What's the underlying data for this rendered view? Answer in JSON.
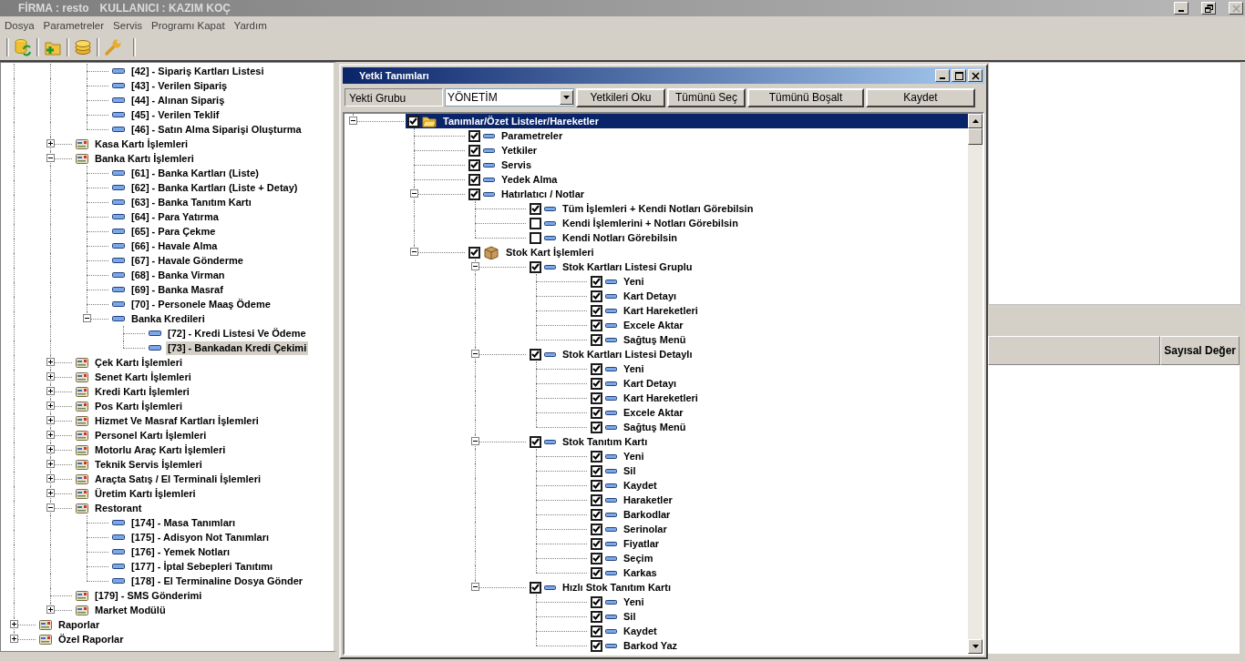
{
  "app_title": {
    "firm": "FİRMA : resto",
    "user": "KULLANICI : KAZIM KOÇ"
  },
  "menu": [
    "Dosya",
    "Parametreler",
    "Servis",
    "Programı Kapat",
    "Yardım"
  ],
  "nav_tree": [
    {
      "children": [
        {
          "children": [
            {
              "label": "[42] - Sipariş Kartları Listesi",
              "kind": "item",
              "selected": false
            },
            {
              "label": "[43] - Verilen Sipariş",
              "kind": "item",
              "selected": false
            },
            {
              "label": "[44] - Alınan Sipariş",
              "kind": "item",
              "selected": false
            },
            {
              "label": "[45] - Verilen Teklif",
              "kind": "item",
              "selected": false
            },
            {
              "label": "[46] - Satın Alma Siparişi Oluşturma",
              "kind": "item",
              "selected": false
            }
          ]
        },
        {
          "label": "Kasa Kartı İşlemleri",
          "kind": "module",
          "expanded": false,
          "selected": false
        },
        {
          "label": "Banka Kartı İşlemleri",
          "kind": "module",
          "expanded": true,
          "selected": false,
          "children": [
            {
              "label": "[61] - Banka Kartları (Liste)",
              "kind": "item",
              "selected": false
            },
            {
              "label": "[62] - Banka Kartları (Liste + Detay)",
              "kind": "item",
              "selected": false
            },
            {
              "label": "[63] - Banka Tanıtım Kartı",
              "kind": "item",
              "selected": false
            },
            {
              "label": "[64] - Para Yatırma",
              "kind": "item",
              "selected": false
            },
            {
              "label": "[65] - Para Çekme",
              "kind": "item",
              "selected": false
            },
            {
              "label": "[66] - Havale Alma",
              "kind": "item",
              "selected": false
            },
            {
              "label": "[67] - Havale Gönderme",
              "kind": "item",
              "selected": false
            },
            {
              "label": "[68] - Banka Virman",
              "kind": "item",
              "selected": false
            },
            {
              "label": "[69] - Banka Masraf",
              "kind": "item",
              "selected": false
            },
            {
              "label": "[70] - Personele Maaş Ödeme",
              "kind": "item",
              "selected": false
            },
            {
              "label": "Banka Kredileri",
              "kind": "item",
              "expanded": true,
              "selected": false,
              "children": [
                {
                  "label": "[72] - Kredi Listesi Ve Ödeme",
                  "kind": "item",
                  "selected": false
                },
                {
                  "label": "[73] - Bankadan Kredi Çekimi",
                  "kind": "item",
                  "selected": true
                }
              ]
            }
          ]
        },
        {
          "label": "Çek Kartı İşlemleri",
          "kind": "module",
          "expanded": false,
          "selected": false
        },
        {
          "label": "Senet Kartı İşlemleri",
          "kind": "module",
          "expanded": false,
          "selected": false
        },
        {
          "label": "Kredi Kartı İşlemleri",
          "kind": "module",
          "expanded": false,
          "selected": false
        },
        {
          "label": "Pos Kartı İşlemleri",
          "kind": "module",
          "expanded": false,
          "selected": false
        },
        {
          "label": "Hizmet Ve Masraf Kartları İşlemleri",
          "kind": "module",
          "expanded": false,
          "selected": false
        },
        {
          "label": "Personel Kartı İşlemleri",
          "kind": "module",
          "expanded": false,
          "selected": false
        },
        {
          "label": "Motorlu Araç Kartı İşlemleri",
          "kind": "module",
          "expanded": false,
          "selected": false
        },
        {
          "label": "Teknik Servis İşlemleri",
          "kind": "module",
          "expanded": false,
          "selected": false
        },
        {
          "label": "Araçta Satış / El Terminali İşlemleri",
          "kind": "module",
          "expanded": false,
          "selected": false
        },
        {
          "label": "Üretim Kartı İşlemleri",
          "kind": "module",
          "expanded": false,
          "selected": false
        },
        {
          "label": "Restorant",
          "kind": "module",
          "expanded": true,
          "selected": false,
          "children": [
            {
              "label": "[174] - Masa Tanımları",
              "kind": "item",
              "selected": false
            },
            {
              "label": "[175] - Adisyon Not Tanımları",
              "kind": "item",
              "selected": false
            },
            {
              "label": "[176] - Yemek Notları",
              "kind": "item",
              "selected": false
            },
            {
              "label": "[177] - İptal Sebepleri Tanıtımı",
              "kind": "item",
              "selected": false
            },
            {
              "label": "[178] - El Terminaline Dosya Gönder",
              "kind": "item",
              "selected": false
            }
          ]
        },
        {
          "label": "[179] - SMS Gönderimi",
          "kind": "module",
          "selected": false
        },
        {
          "label": "Market Modülü",
          "kind": "module",
          "expanded": false,
          "selected": false
        }
      ]
    },
    {
      "label": "Raporlar",
      "kind": "module",
      "expanded": false,
      "selected": false
    },
    {
      "label": "Özel Raporlar",
      "kind": "module",
      "expanded": false,
      "selected": false
    }
  ],
  "dialog": {
    "title": "Yetki Tanımları",
    "group_label": "Yekti Grubu",
    "group_value": "YÖNETİM",
    "buttons": [
      "Yetkileri Oku",
      "Tümünü Seç",
      "Tümünü Boşalt",
      "Kaydet"
    ],
    "tree": [
      {
        "label": "Tanımlar/Özet Listeler/Hareketler",
        "kind": "folder",
        "checked": true,
        "expanded": true,
        "selected": true,
        "children": [
          {
            "label": "Parametreler",
            "kind": "item",
            "checked": true,
            "selected": false
          },
          {
            "label": "Yetkiler",
            "kind": "item",
            "checked": true,
            "selected": false
          },
          {
            "label": "Servis",
            "kind": "item",
            "checked": true,
            "selected": false
          },
          {
            "label": "Yedek Alma",
            "kind": "item",
            "checked": true,
            "selected": false
          },
          {
            "label": "Hatırlatıcı / Notlar",
            "kind": "item",
            "checked": true,
            "expanded": true,
            "selected": false,
            "children": [
              {
                "label": "Tüm İşlemleri + Kendi Notları Görebilsin",
                "kind": "item",
                "checked": true,
                "selected": false
              },
              {
                "label": "Kendi İşlemlerini + Notları Görebilsin",
                "kind": "item",
                "checked": false,
                "selected": false
              },
              {
                "label": "Kendi Notları Görebilsin",
                "kind": "item",
                "checked": false,
                "selected": false
              }
            ]
          },
          {
            "label": "Stok Kart İşlemleri",
            "kind": "box",
            "checked": true,
            "expanded": true,
            "selected": false,
            "children": [
              {
                "label": "Stok Kartları Listesi Gruplu",
                "kind": "item",
                "checked": true,
                "expanded": true,
                "selected": false,
                "children": [
                  {
                    "label": "Yeni",
                    "kind": "item",
                    "checked": true,
                    "selected": false
                  },
                  {
                    "label": "Kart Detayı",
                    "kind": "item",
                    "checked": true,
                    "selected": false
                  },
                  {
                    "label": "Kart Hareketleri",
                    "kind": "item",
                    "checked": true,
                    "selected": false
                  },
                  {
                    "label": "Excele Aktar",
                    "kind": "item",
                    "checked": true,
                    "selected": false
                  },
                  {
                    "label": "Sağtuş Menü",
                    "kind": "item",
                    "checked": true,
                    "selected": false
                  }
                ]
              },
              {
                "label": "Stok Kartları Listesi Detaylı",
                "kind": "item",
                "checked": true,
                "expanded": true,
                "selected": false,
                "children": [
                  {
                    "label": "Yeni",
                    "kind": "item",
                    "checked": true,
                    "selected": false
                  },
                  {
                    "label": "Kart Detayı",
                    "kind": "item",
                    "checked": true,
                    "selected": false
                  },
                  {
                    "label": "Kart Hareketleri",
                    "kind": "item",
                    "checked": true,
                    "selected": false
                  },
                  {
                    "label": "Excele Aktar",
                    "kind": "item",
                    "checked": true,
                    "selected": false
                  },
                  {
                    "label": "Sağtuş Menü",
                    "kind": "item",
                    "checked": true,
                    "selected": false
                  }
                ]
              },
              {
                "label": "Stok Tanıtım Kartı",
                "kind": "item",
                "checked": true,
                "expanded": true,
                "selected": false,
                "children": [
                  {
                    "label": "Yeni",
                    "kind": "item",
                    "checked": true,
                    "selected": false
                  },
                  {
                    "label": "Sil",
                    "kind": "item",
                    "checked": true,
                    "selected": false
                  },
                  {
                    "label": "Kaydet",
                    "kind": "item",
                    "checked": true,
                    "selected": false
                  },
                  {
                    "label": "Haraketler",
                    "kind": "item",
                    "checked": true,
                    "selected": false
                  },
                  {
                    "label": "Barkodlar",
                    "kind": "item",
                    "checked": true,
                    "selected": false
                  },
                  {
                    "label": "Serinolar",
                    "kind": "item",
                    "checked": true,
                    "selected": false
                  },
                  {
                    "label": "Fiyatlar",
                    "kind": "item",
                    "checked": true,
                    "selected": false
                  },
                  {
                    "label": "Seçim",
                    "kind": "item",
                    "checked": true,
                    "selected": false
                  },
                  {
                    "label": "Karkas",
                    "kind": "item",
                    "checked": true,
                    "selected": false
                  }
                ]
              },
              {
                "label": "Hızlı Stok Tanıtım Kartı",
                "kind": "item",
                "checked": true,
                "expanded": true,
                "selected": false,
                "children": [
                  {
                    "label": "Yeni",
                    "kind": "item",
                    "checked": true,
                    "selected": false
                  },
                  {
                    "label": "Sil",
                    "kind": "item",
                    "checked": true,
                    "selected": false
                  },
                  {
                    "label": "Kaydet",
                    "kind": "item",
                    "checked": true,
                    "selected": false
                  },
                  {
                    "label": "Barkod Yaz",
                    "kind": "item",
                    "checked": true,
                    "selected": false
                  }
                ]
              }
            ]
          }
        ]
      }
    ]
  },
  "grid": {
    "columns": [
      "Sayısal Değer"
    ]
  }
}
